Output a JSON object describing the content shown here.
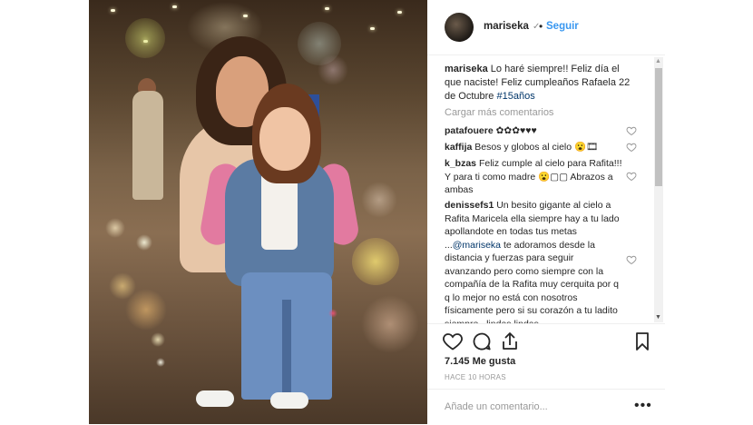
{
  "post": {
    "username": "mariseka",
    "verified_glyph": "✓",
    "separator": "•",
    "follow_label": "Seguir"
  },
  "caption": {
    "username": "mariseka",
    "text": "Lo haré siempre!! Feliz día el que naciste! Feliz cumpleaños Rafaela 22 de Octubre",
    "hashtag": "#15años"
  },
  "load_more": "Cargar más comentarios",
  "comments": [
    {
      "username": "patafouere",
      "text": "✿✿✿♥♥♥"
    },
    {
      "username": "kaffija",
      "text": "Besos y globos al cielo 😮🎞"
    },
    {
      "username": "k_bzas",
      "text": "Feliz cumple al cielo para Rafita!!! Y para ti como madre 😮▢▢ Abrazos a ambas"
    },
    {
      "username": "denissefs1",
      "text_before": "Un besito gigante al cielo a Rafita Maricela ella siempre hay a tu lado apollandote en todas tus metas ...",
      "mention": "@mariseka",
      "text_after": " te adoramos desde la distancia y fuerzas para seguir avanzando pero como siempre con la compañía de la Rafita muy cerquita por q q lo mejor no está con nosotros físicamente pero si su corazón a tu ladito siempre...lindas lindas"
    }
  ],
  "likes": "7.145 Me gusta",
  "timestamp": "HACE 10 HORAS",
  "add_comment_placeholder": "Añade un comentario...",
  "more_options": "•••",
  "icons": [
    "heart-icon",
    "comment-icon",
    "share-icon",
    "bookmark-icon",
    "more-options-icon"
  ],
  "colors": {
    "link": "#3897f0",
    "mention": "#003569",
    "muted": "#999999",
    "text": "#262626"
  }
}
